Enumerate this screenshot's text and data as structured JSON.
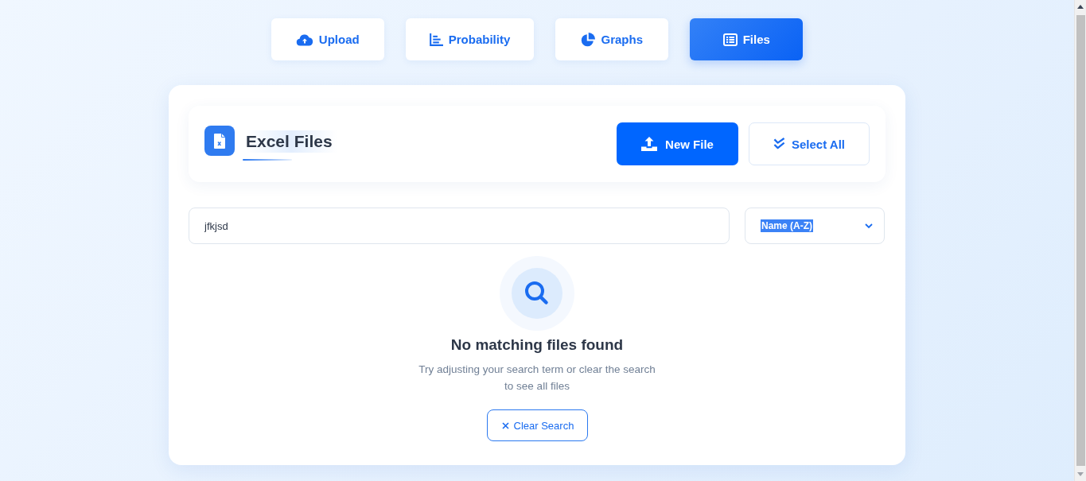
{
  "nav_tabs": [
    {
      "label": "Upload",
      "selected": false
    },
    {
      "label": "Probability",
      "selected": false
    },
    {
      "label": "Graphs",
      "selected": false
    },
    {
      "label": "Files",
      "selected": true
    }
  ],
  "header": {
    "title": "Excel Files",
    "buttons": [
      {
        "label": "New File",
        "kind": "primary"
      },
      {
        "label": "Select All",
        "kind": "secondary"
      }
    ]
  },
  "search": {
    "value": "jfkjsd"
  },
  "sort": {
    "value": "Name (A-Z)",
    "text_selected": true
  },
  "empty_state": {
    "title": "No matching files found",
    "message": "Try adjusting your search term or clear the search to see all files",
    "button": "Clear Search"
  }
}
